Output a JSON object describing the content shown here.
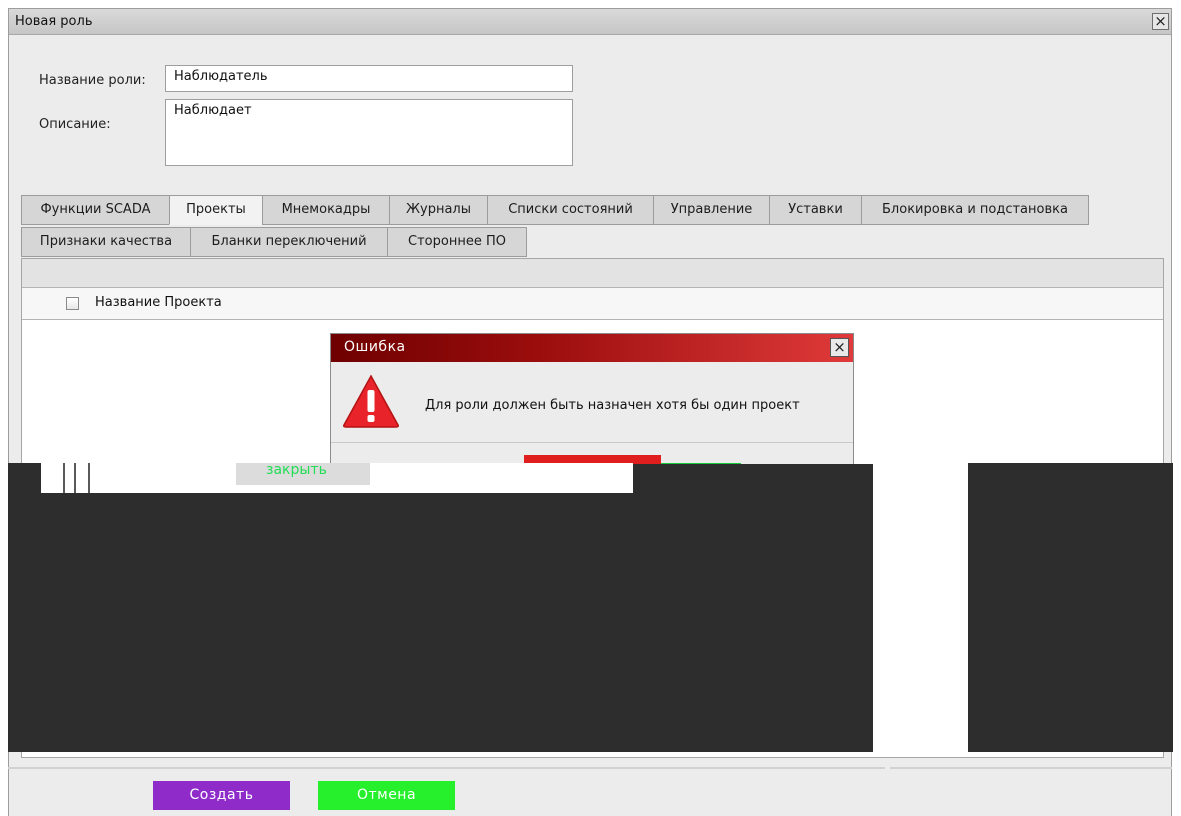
{
  "window": {
    "title": "Новая роль"
  },
  "form": {
    "name_label": "Название роли:",
    "name_value": "Наблюдатель",
    "description_label": "Описание:",
    "description_value": "Наблюдает"
  },
  "tabs_row1": [
    "Функции SCADA",
    "Проекты",
    "Мнемокадры",
    "Журналы",
    "Списки состояний",
    "Управление",
    "Уставки",
    "Блокировка и подстановка"
  ],
  "tabs_row2": [
    "Признаки качества",
    "Бланки переключений",
    "Стороннее ПО"
  ],
  "active_tab": "Проекты",
  "table": {
    "column_header": "Название Проекта",
    "header_checked": false
  },
  "error_dialog": {
    "title": "Ошибка",
    "message": "Для роли должен быть назначен хотя бы один проект",
    "close_label": "закрыть"
  },
  "buttons": {
    "create": "Создать",
    "cancel": "Отмена"
  },
  "colors": {
    "dialog_title": "#9b0d0d",
    "create_button": "#8e2bc9",
    "cancel_button": "#25f02b",
    "warning_icon": "#e8232a"
  },
  "icons": {
    "warning": "warning-icon",
    "close": "close-icon"
  }
}
